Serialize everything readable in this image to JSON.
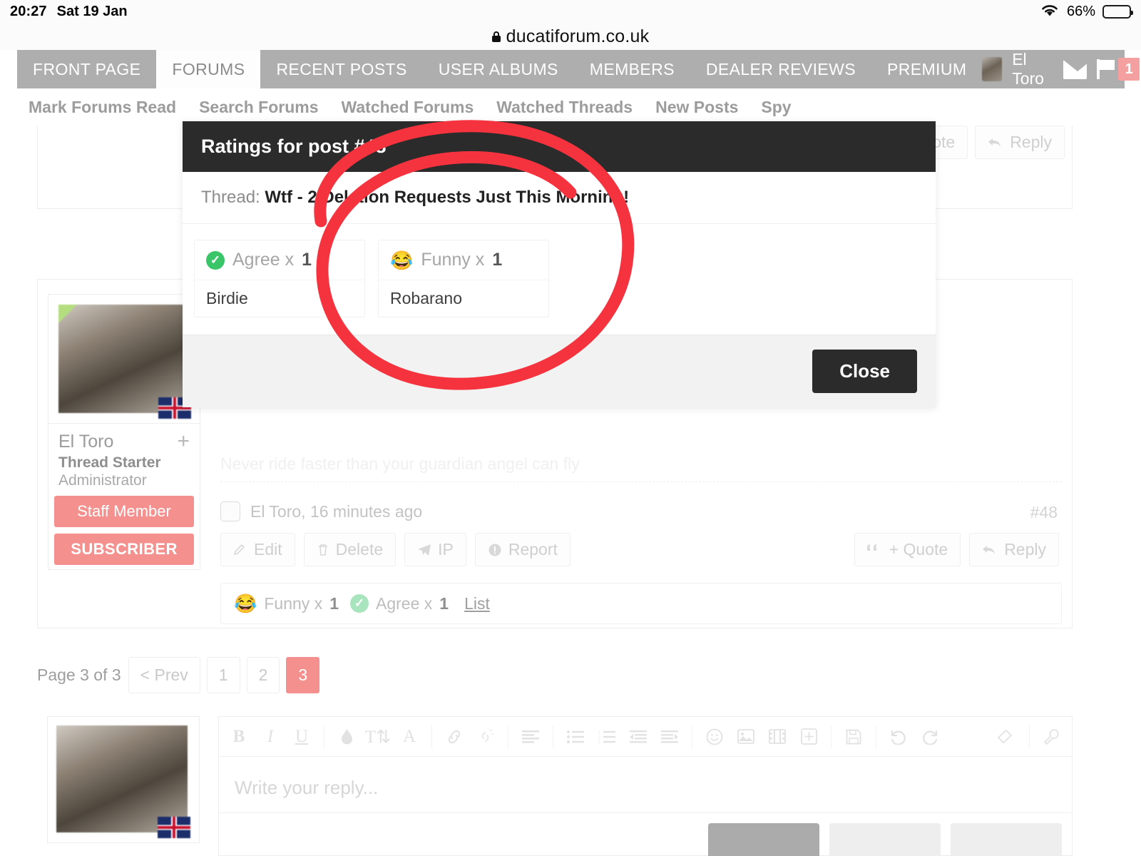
{
  "status_bar": {
    "time": "20:27",
    "date": "Sat 19 Jan",
    "battery_percent": "66%",
    "wifi_icon": "wifi-icon",
    "battery_icon": "battery-icon"
  },
  "browser": {
    "url": "ducatiforum.co.uk",
    "lock_icon": "lock-icon"
  },
  "main_nav": {
    "items": [
      {
        "label": "FRONT PAGE",
        "active": false
      },
      {
        "label": "FORUMS",
        "active": true
      },
      {
        "label": "RECENT POSTS",
        "active": false
      },
      {
        "label": "USER ALBUMS",
        "active": false
      },
      {
        "label": "MEMBERS",
        "active": false
      },
      {
        "label": "DEALER REVIEWS",
        "active": false
      },
      {
        "label": "PREMIUM",
        "active": false
      }
    ],
    "username": "El Toro",
    "inbox_icon": "envelope-icon",
    "alerts_icon": "flag-icon",
    "alerts_count": "1"
  },
  "sub_nav": {
    "items": [
      "Mark Forums Read",
      "Search Forums",
      "Watched Forums",
      "Watched Threads",
      "New Posts",
      "Spy"
    ]
  },
  "modal": {
    "title": "Ratings for post #48",
    "thread_label": "Thread:",
    "thread_title": "Wtf - 2 Deletion Requests Just This Morning!",
    "ratings": [
      {
        "icon": "check-circle-icon",
        "label": "Agree x",
        "count": "1",
        "users": [
          "Birdie"
        ]
      },
      {
        "icon": "joy-emoji-icon",
        "label": "Funny x",
        "count": "1",
        "users": [
          "Robarano"
        ]
      }
    ],
    "close_label": "Close"
  },
  "post_top": {
    "quote_label": "+ Quote",
    "reply_label": "Reply"
  },
  "post": {
    "user": {
      "name": "El Toro",
      "role": "Thread Starter",
      "rank": "Administrator",
      "badges": [
        "Staff Member",
        "SUBSCRIBER"
      ],
      "avatar_icon": "bull-avatar",
      "flag_icon": "uk-flag-icon",
      "add_icon": "plus-icon"
    },
    "signature": "Never ride faster than your guardian angel can fly",
    "meta": "El Toro, 16 minutes ago",
    "post_number": "#48",
    "actions": [
      {
        "label": "Edit",
        "icon": "pencil-icon"
      },
      {
        "label": "Delete",
        "icon": "trash-icon"
      },
      {
        "label": "IP",
        "icon": "paper-plane-icon"
      },
      {
        "label": "Report",
        "icon": "warning-icon"
      }
    ],
    "actions_right": [
      {
        "label": "+ Quote",
        "icon": "quote-icon"
      },
      {
        "label": "Reply",
        "icon": "reply-arrow-icon"
      }
    ],
    "ratings_bar": {
      "items": [
        {
          "icon": "joy-emoji-icon",
          "label": "Funny x",
          "count": "1"
        },
        {
          "icon": "check-circle-icon",
          "label": "Agree x",
          "count": "1"
        }
      ],
      "list_label": "List"
    }
  },
  "pagination": {
    "label": "Page 3 of 3",
    "prev_label": "< Prev",
    "pages": [
      {
        "label": "1",
        "active": false
      },
      {
        "label": "2",
        "active": false
      },
      {
        "label": "3",
        "active": true
      }
    ]
  },
  "editor": {
    "placeholder": "Write your reply...",
    "toolbar": [
      {
        "name": "bold-icon",
        "glyph": "B"
      },
      {
        "name": "italic-icon",
        "glyph": "I"
      },
      {
        "name": "underline-icon",
        "glyph": "U"
      },
      {
        "name": "text-color-icon",
        "glyph": "◆"
      },
      {
        "name": "font-size-icon",
        "glyph": "T"
      },
      {
        "name": "font-family-icon",
        "glyph": "A"
      },
      {
        "name": "link-icon",
        "glyph": "⛓"
      },
      {
        "name": "unlink-icon",
        "glyph": "⛓"
      },
      {
        "name": "align-icon",
        "glyph": "≡"
      },
      {
        "name": "bullet-list-icon",
        "glyph": "☰"
      },
      {
        "name": "numbered-list-icon",
        "glyph": "☰"
      },
      {
        "name": "outdent-icon",
        "glyph": "⬅"
      },
      {
        "name": "indent-icon",
        "glyph": "➡"
      },
      {
        "name": "smiley-icon",
        "glyph": "☺"
      },
      {
        "name": "image-icon",
        "glyph": "Ὓc"
      },
      {
        "name": "video-icon",
        "glyph": "Ἱe"
      },
      {
        "name": "insert-icon",
        "glyph": "⊞"
      },
      {
        "name": "save-draft-icon",
        "glyph": "Ὃe"
      },
      {
        "name": "undo-icon",
        "glyph": "↺"
      },
      {
        "name": "redo-icon",
        "glyph": "↻"
      },
      {
        "name": "eraser-icon",
        "glyph": "▱"
      },
      {
        "name": "settings-wrench-icon",
        "glyph": "ὒ7"
      }
    ]
  },
  "colors": {
    "accent_pink": "#f4918f",
    "nav_gray": "#aeaeae",
    "modal_dark": "#2b2b2b",
    "annotation_red": "#f5333f",
    "agree_green": "#3ac569"
  }
}
